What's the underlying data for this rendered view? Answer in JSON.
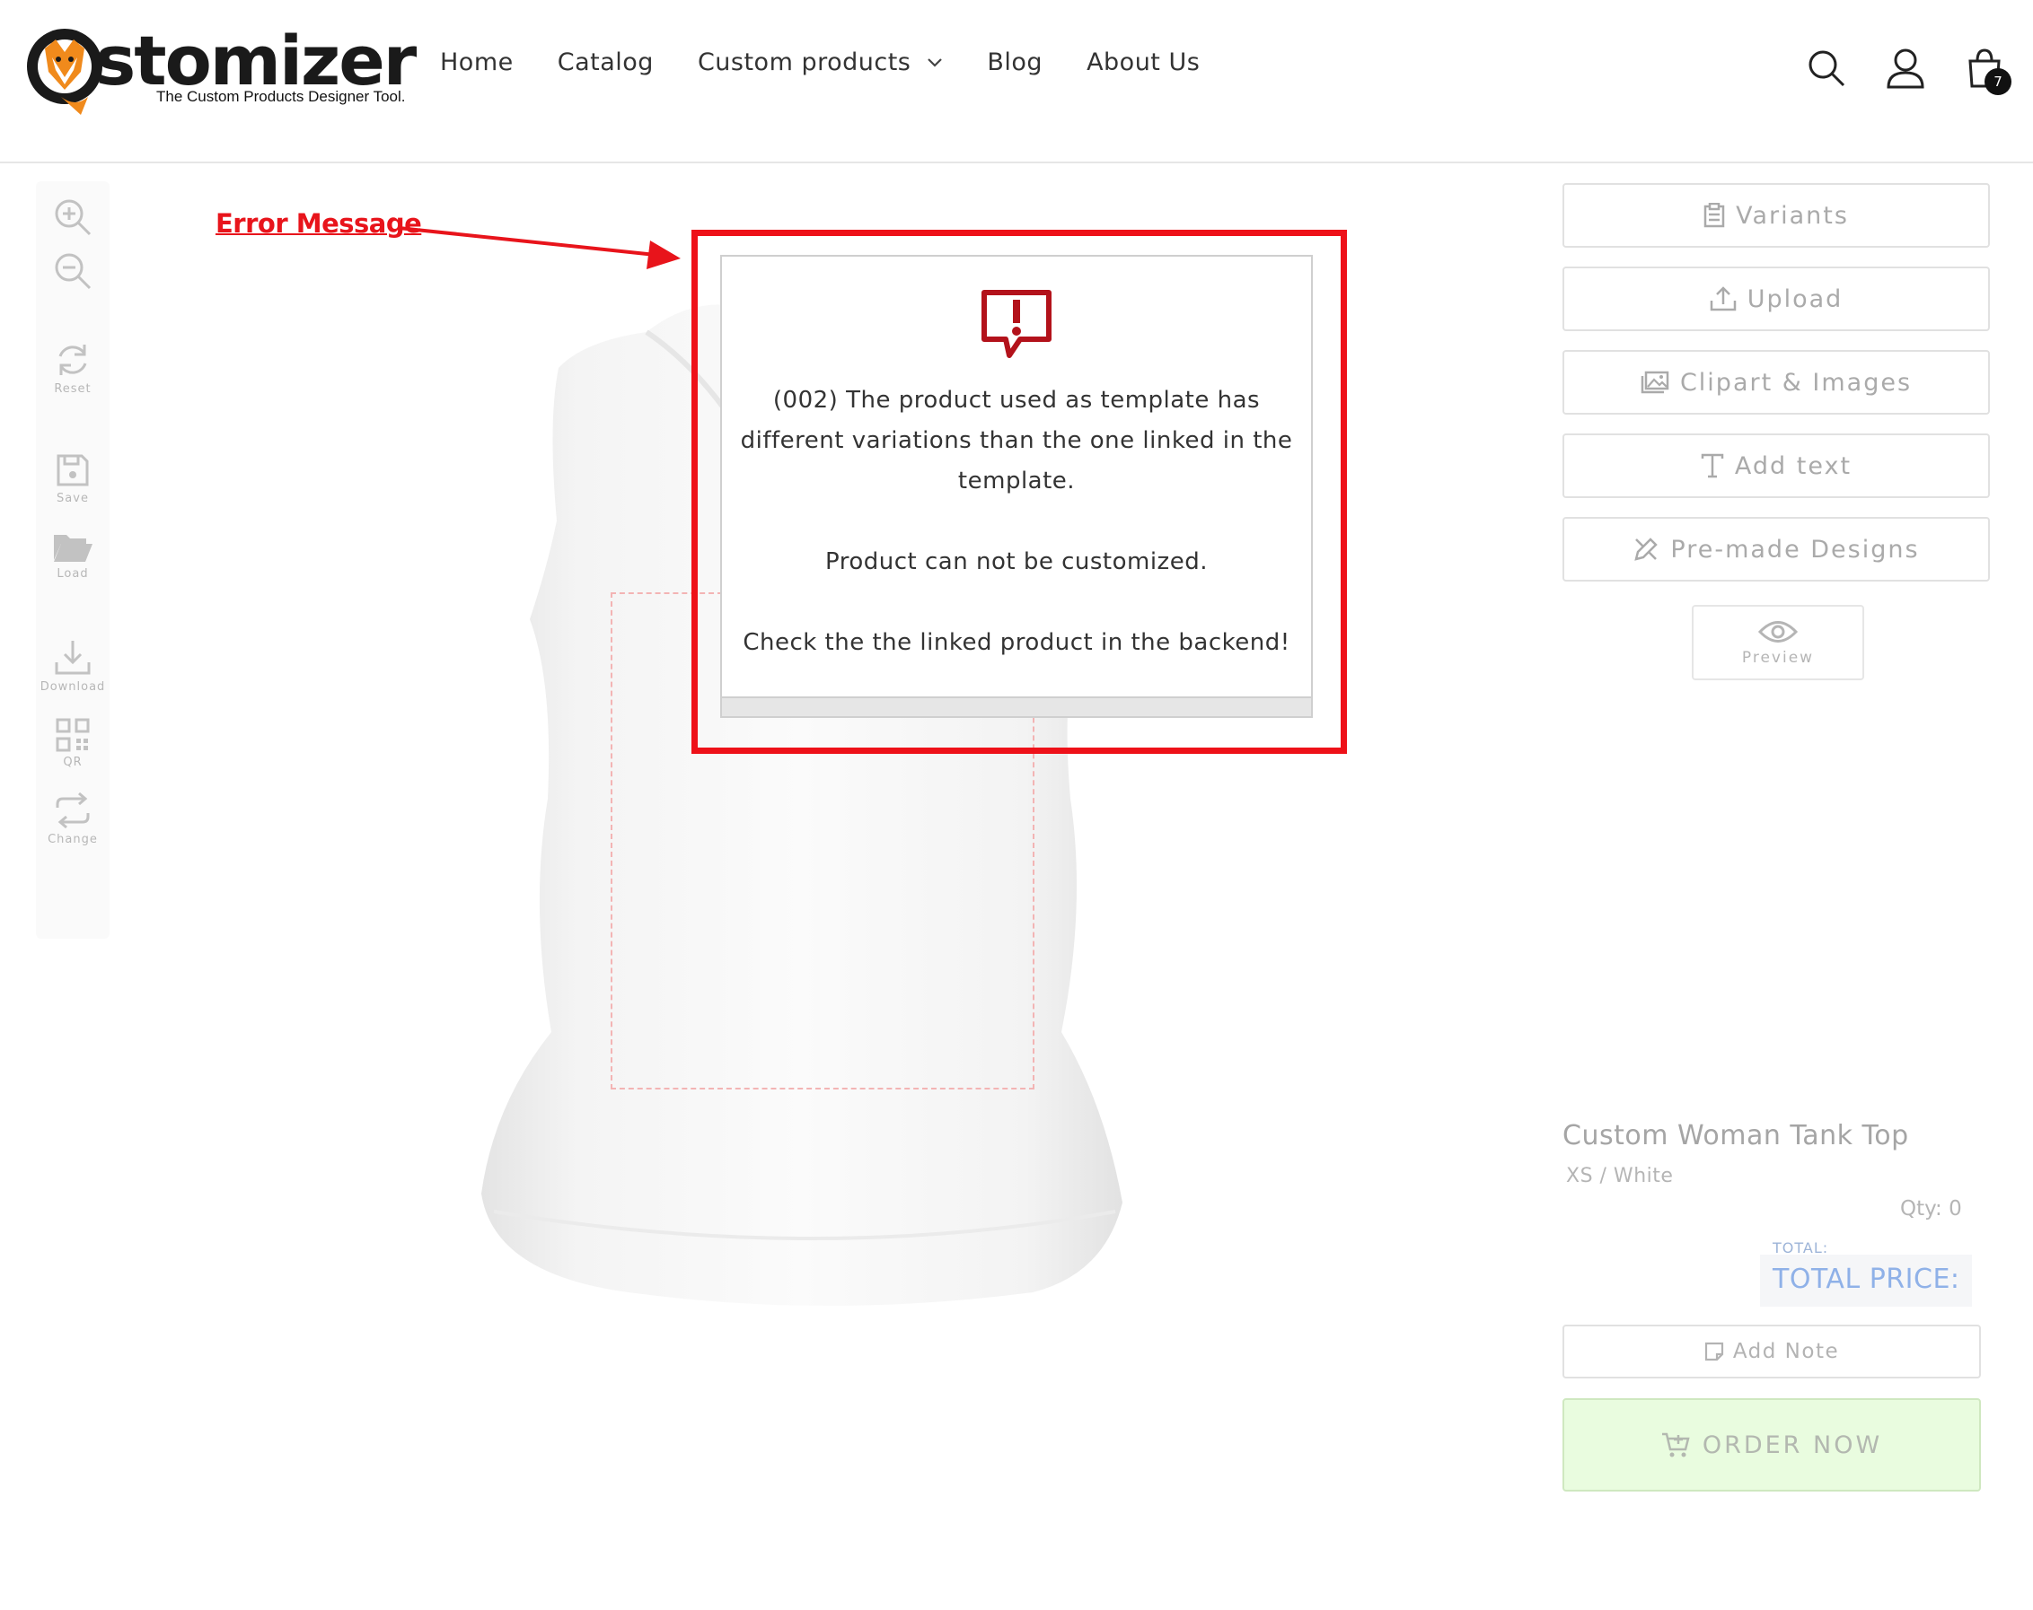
{
  "header": {
    "logo_wordmark": "stomizer",
    "logo_tagline": "The Custom Products Designer Tool.",
    "nav": [
      {
        "label": "Home"
      },
      {
        "label": "Catalog"
      },
      {
        "label": "Custom products",
        "has_dropdown": true
      },
      {
        "label": "Blog"
      },
      {
        "label": "About Us"
      }
    ],
    "cart_count": "7",
    "icons": [
      "search-icon",
      "account-icon",
      "cart-icon"
    ]
  },
  "toolbar": {
    "tools": [
      {
        "name": "zoom-in",
        "label": ""
      },
      {
        "name": "zoom-out",
        "label": ""
      },
      {
        "name": "reset",
        "label": "Reset"
      },
      {
        "name": "save",
        "label": "Save"
      },
      {
        "name": "load",
        "label": "Load"
      },
      {
        "name": "download",
        "label": "Download"
      },
      {
        "name": "qr",
        "label": "QR"
      },
      {
        "name": "change",
        "label": "Change"
      }
    ]
  },
  "annotation": {
    "label": "Error Message",
    "color": "#ee1119"
  },
  "modal": {
    "icon": "alert-bubble-icon",
    "icon_color": "#b3121b",
    "line1": "(002) The product used as template has",
    "line2": "different variations than the one linked in the",
    "line3": "template.",
    "line4": "Product can not be customized.",
    "line5": "Check the the linked product in the backend!"
  },
  "panel": {
    "buttons": [
      {
        "label": "Variants",
        "icon": "clipboard-icon"
      },
      {
        "label": "Upload",
        "icon": "upload-icon"
      },
      {
        "label": "Clipart & Images",
        "icon": "images-icon"
      },
      {
        "label": "Add text",
        "icon": "text-icon"
      },
      {
        "label": "Pre-made Designs",
        "icon": "design-icon"
      }
    ],
    "preview_label": "Preview"
  },
  "product": {
    "title": "Custom Woman Tank Top",
    "variant": "XS / White",
    "qty": "Qty: 0",
    "total_small": "TOTAL:",
    "total_big": "TOTAL PRICE:",
    "add_note": "Add Note",
    "order_now": "ORDER NOW",
    "order_color": "#e9fcdf"
  }
}
